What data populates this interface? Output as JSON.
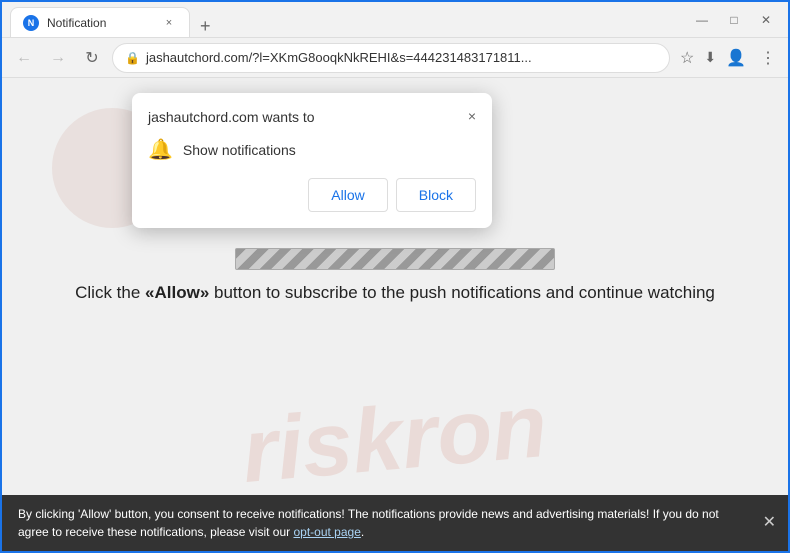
{
  "browser": {
    "title": "Notification",
    "favicon_letter": "N",
    "tab_close": "×",
    "new_tab": "+",
    "url": "jashautchord.com/?l=XKmG8ooqkNkREHI&s=444231483171811...",
    "window_controls": {
      "minimize": "—",
      "maximize": "□",
      "close": "✕"
    },
    "nav": {
      "back": "←",
      "forward": "→",
      "refresh": "↻"
    }
  },
  "popup": {
    "title": "jashautchord.com wants to",
    "close_icon": "×",
    "permission_icon": "🔔",
    "permission_text": "Show notifications",
    "allow_label": "Allow",
    "block_label": "Block"
  },
  "page": {
    "instructions": "Click the «Allow» button to subscribe to the push notifications and continue watching",
    "allow_highlight": "«Allow»"
  },
  "bottom_bar": {
    "text_before_link": "By clicking 'Allow' button, you consent to receive notifications! The notifications provide news and advertising materials! If you do not agree to receive these notifications, please visit our ",
    "link_text": "opt-out page",
    "text_after_link": ".",
    "close_icon": "✕"
  },
  "watermark": {
    "text": "riskron"
  }
}
